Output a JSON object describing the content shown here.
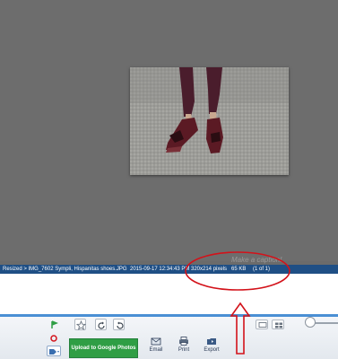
{
  "caption": {
    "placeholder": "Make a caption!"
  },
  "infobar": {
    "path": "Resized > IMG_7602 Sympli, Hispanitas shoes.JPG",
    "date": "2015-09-17 12:34:43 PM",
    "dimensions": "320x214 pixels",
    "size": "65 KB",
    "index": "(1 of 1)"
  },
  "toolbar": {
    "upload_label": "Upload to Google Photos",
    "email_label": "Email",
    "print_label": "Print",
    "export_label": "Export"
  },
  "colors": {
    "viewer_bg": "#6d6d6d",
    "infobar_bg": "#1f4f85",
    "upload_green": "#2f9e45",
    "annotation_red": "#d3121a"
  },
  "icons": [
    "star-icon",
    "rotate-left-icon",
    "rotate-right-icon",
    "green-flag-icon",
    "red-eye-icon",
    "tag-icon",
    "email-icon",
    "print-icon",
    "export-icon",
    "single-view-icon",
    "grid-view-icon"
  ]
}
